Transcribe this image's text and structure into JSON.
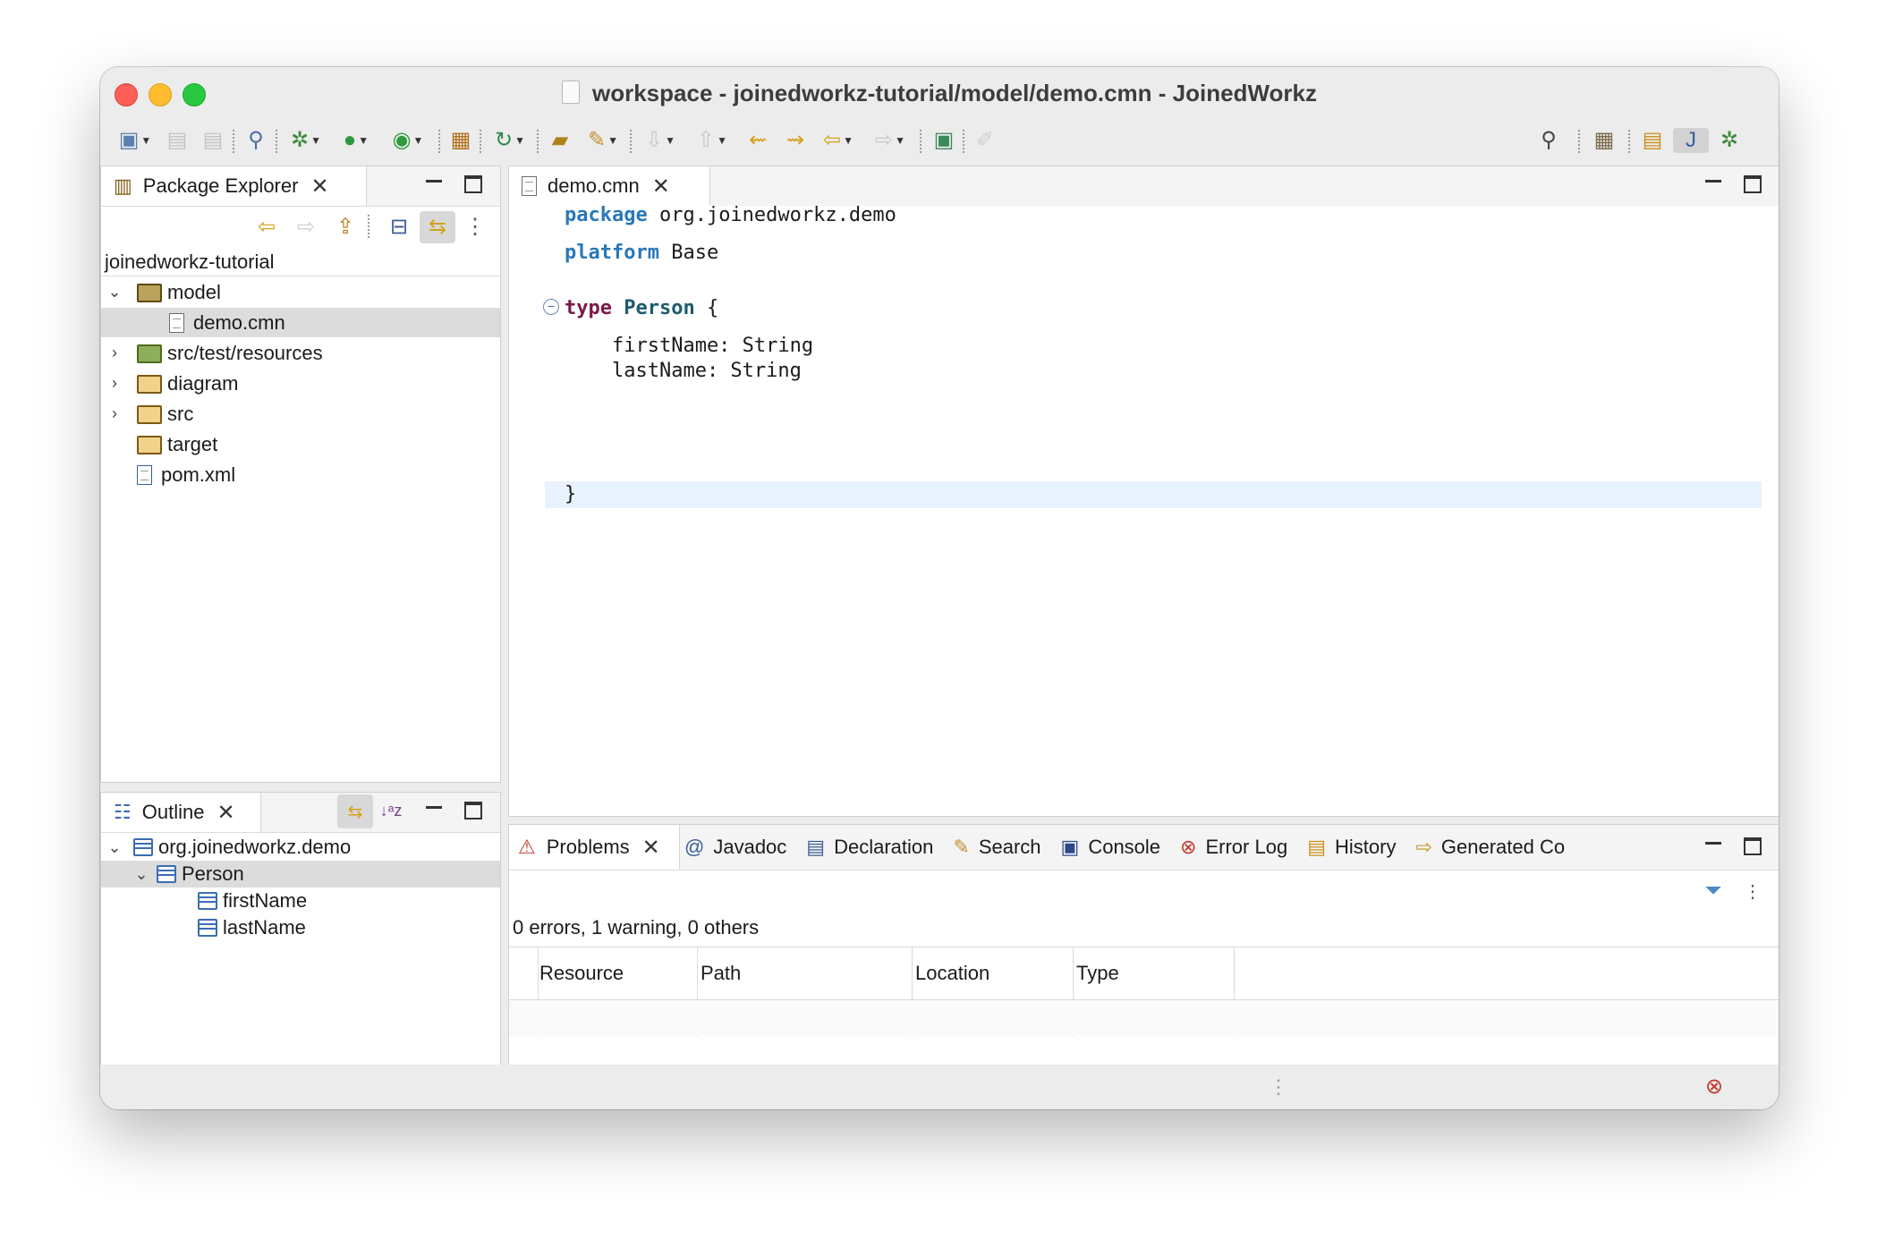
{
  "window": {
    "title": "workspace - joinedworkz-tutorial/model/demo.cmn - JoinedWorkz"
  },
  "toolbar": {
    "icons": [
      "new-icon",
      "save-icon",
      "save-all-icon",
      "search-tool-icon",
      "debug-icon",
      "run-icon",
      "external-tools-icon",
      "package-icon",
      "refresh-icon",
      "open-type-icon",
      "open-task-icon",
      "next-annotation-icon",
      "prev-annotation-icon",
      "back-icon",
      "forward-icon",
      "pin-icon",
      "edit-icon",
      "search-icon",
      "open-perspective-icon",
      "resource-perspective-icon",
      "java-perspective-icon",
      "debug-perspective-icon"
    ]
  },
  "package_explorer": {
    "tab_label": "Package Explorer",
    "project": "joinedworkz-tutorial",
    "items": [
      {
        "label": "model",
        "expanded": true,
        "type": "folder"
      },
      {
        "label": "demo.cmn",
        "type": "file",
        "selected": true
      },
      {
        "label": "src/test/resources",
        "type": "source-folder"
      },
      {
        "label": "diagram",
        "type": "folder"
      },
      {
        "label": "src",
        "type": "folder"
      },
      {
        "label": "target",
        "type": "folder"
      },
      {
        "label": "pom.xml",
        "type": "maven-file"
      }
    ]
  },
  "outline": {
    "tab_label": "Outline",
    "items": [
      {
        "label": "org.joinedworkz.demo"
      },
      {
        "label": "Person",
        "selected": true
      },
      {
        "label": "firstName"
      },
      {
        "label": "lastName"
      }
    ]
  },
  "editor": {
    "tab_label": "demo.cmn",
    "code": {
      "l1_kw": "package",
      "l1_rest": " org.joinedworkz.demo",
      "l2_kw": "platform",
      "l2_rest": " Base",
      "l3_kw": "type",
      "l3_name": "Person",
      "l3_rest": " {",
      "l4": "    firstName: String",
      "l5": "    lastName: String",
      "l6": "}"
    }
  },
  "bottom_panel": {
    "tabs": [
      "Problems",
      "Javadoc",
      "Declaration",
      "Search",
      "Console",
      "Error Log",
      "History",
      "Generated Co"
    ],
    "summary": "0 errors, 1 warning, 0 others",
    "columns": [
      "Resource",
      "Path",
      "Location",
      "Type"
    ]
  },
  "colors": {
    "keyword": "#2a78b8",
    "type_keyword": "#7a1a4a",
    "type_name": "#1d5c6e",
    "current_line": "#e8f2fe",
    "selection": "#dcdcdc"
  }
}
